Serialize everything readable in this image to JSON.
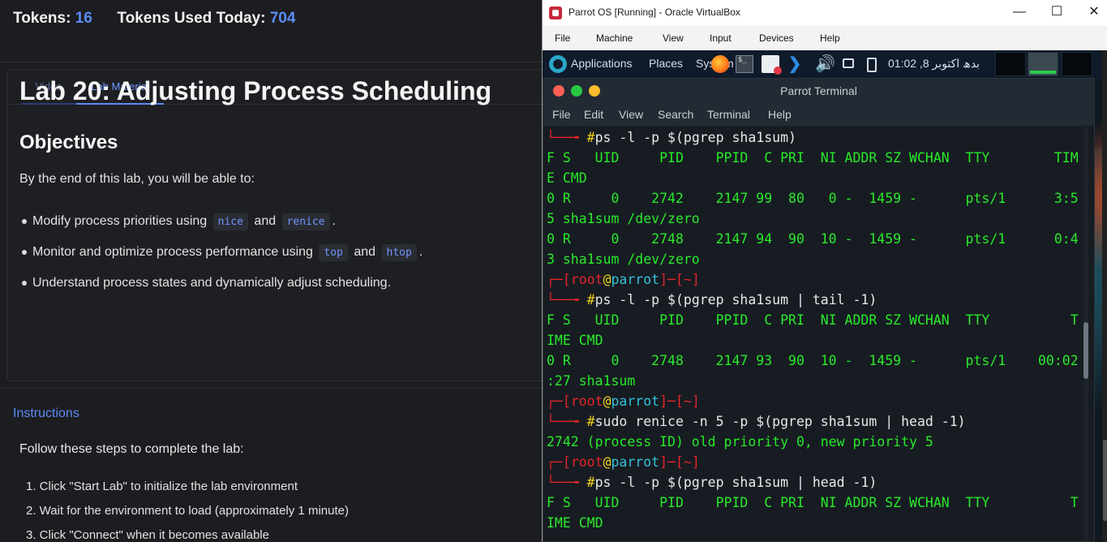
{
  "header": {
    "tokens_label": "Tokens:",
    "tokens_value": "16",
    "tokens_today_label": "Tokens Used Today:",
    "tokens_today_value": "704"
  },
  "tabs": {
    "video": "Video",
    "lab_material": "Lab Material"
  },
  "lab": {
    "title": "Lab 20: Adjusting Process Scheduling",
    "objectives_heading": "Objectives",
    "objectives_intro": "By the end of this lab, you will be able to:",
    "objectives": [
      {
        "pre": "Modify process priorities using",
        "code1": "nice",
        "mid": "and",
        "code2": "renice",
        "post": "."
      },
      {
        "pre": "Monitor and optimize process performance using",
        "code1": "top",
        "mid": "and",
        "code2": "htop",
        "post": "."
      },
      {
        "text": "Understand process states and dynamically adjust scheduling."
      }
    ]
  },
  "instructions": {
    "link": "Instructions",
    "intro": "Follow these steps to complete the lab:",
    "steps": [
      "1. Click \"Start Lab\" to initialize the lab environment",
      "2. Wait for the environment to load (approximately 1 minute)",
      "3. Click \"Connect\" when it becomes available"
    ]
  },
  "vbox": {
    "title": "Parrot OS [Running] - Oracle VirtualBox",
    "controls": [
      "—",
      "☐",
      "✕"
    ],
    "menu": [
      "File",
      "Machine",
      "View",
      "Input",
      "Devices",
      "Help"
    ]
  },
  "panel": {
    "applications": "Applications",
    "places": "Places",
    "system": "System",
    "term_icon_text": "$_",
    "clock": "بدھ اکتوبر 8, 01:02",
    "icons": [
      "parrot-logo-icon",
      "firefox-icon",
      "terminal-icon",
      "document-icon",
      "vscode-icon",
      "volume-icon",
      "chat-icon",
      "battery-icon"
    ]
  },
  "terminal": {
    "title": "Parrot Terminal",
    "menu": [
      "File",
      "Edit",
      "View",
      "Search",
      "Terminal",
      "Help"
    ],
    "colors": {
      "prompt_red": "#e3252a",
      "host_cyan": "#32c2d9",
      "output_green": "#29e92b",
      "hash_yellow": "#f2d31a"
    },
    "prompt": {
      "open": "┌─[",
      "user": "root",
      "at": "@",
      "host": "parrot",
      "dir": "]─[~]",
      "corner": "└──╼ ",
      "hash": "#"
    },
    "cmd1": "ps -l -p $(pgrep sha1sum)",
    "out1": [
      "F S   UID     PID    PPID  C PRI  NI ADDR SZ WCHAN  TTY        TIM",
      "E CMD",
      "0 R     0    2742    2147 99  80   0 -  1459 -      pts/1      3:5",
      "5 sha1sum /dev/zero",
      "0 R     0    2748    2147 94  90  10 -  1459 -      pts/1      0:4",
      "3 sha1sum /dev/zero"
    ],
    "cmd2": "ps -l -p $(pgrep sha1sum | tail -1)",
    "out2": [
      "F S   UID     PID    PPID  C PRI  NI ADDR SZ WCHAN  TTY          T",
      "IME CMD",
      "0 R     0    2748    2147 93  90  10 -  1459 -      pts/1    00:02",
      ":27 sha1sum"
    ],
    "cmd3": "sudo renice -n 5 -p $(pgrep sha1sum | head -1)",
    "out3": [
      "2742 (process ID) old priority 0, new priority 5"
    ],
    "cmd4": "ps -l -p $(pgrep sha1sum | head -1)",
    "out4": [
      "F S   UID     PID    PPID  C PRI  NI ADDR SZ WCHAN  TTY          T",
      "IME CMD"
    ]
  }
}
